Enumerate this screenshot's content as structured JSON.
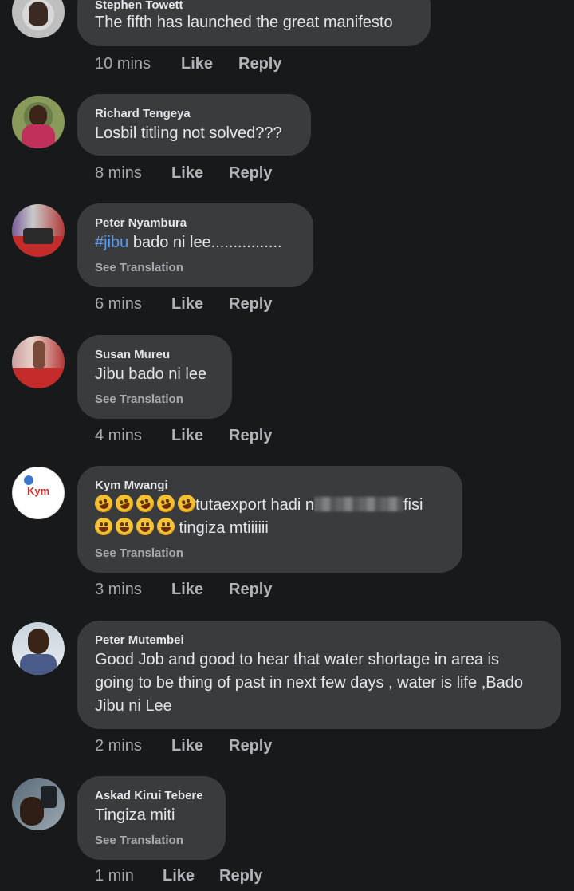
{
  "comments": [
    {
      "author": "Stephen Towett",
      "text": "The fifth has launched the great manifesto",
      "time": "10 mins",
      "like": "Like",
      "reply": "Reply"
    },
    {
      "author": "Richard Tengeya",
      "text": "Losbil titling not solved???",
      "time": "8 mins",
      "like": "Like",
      "reply": "Reply"
    },
    {
      "author": "Peter Nyambura",
      "hashtag": "#jibu",
      "text_rest": " bado ni lee................",
      "translate": "See Translation",
      "time": "6 mins",
      "like": "Like",
      "reply": "Reply"
    },
    {
      "author": "Susan Mureu",
      "text": "Jibu bado ni lee",
      "translate": "See Translation",
      "time": "4 mins",
      "like": "Like",
      "reply": "Reply"
    },
    {
      "author": "Kym Mwangi",
      "avatar_text": "Kym",
      "line1_a": "tutaexport hadi n",
      "line1_b": "fisi",
      "line2": " tingiza mtiiiiii",
      "translate": "See Translation",
      "time": "3 mins",
      "like": "Like",
      "reply": "Reply"
    },
    {
      "author": "Peter Mutembei",
      "lines": [
        "Good Job and good to hear that water shortage in area is",
        "going to be thing of past in next few days , water is life ,Bado",
        "Jibu ni Lee"
      ],
      "time": "2 mins",
      "like": "Like",
      "reply": "Reply"
    },
    {
      "author": "Askad Kirui Tebere",
      "text": "Tingiza miti",
      "translate": "See Translation",
      "time": "1 min",
      "like": "Like",
      "reply": "Reply"
    }
  ],
  "colors": {
    "background": "#18191a",
    "bubble": "#3a3b3c",
    "hashtag": "#5b9bf2"
  },
  "icons": {
    "laugh_emoji": "rolling-on-floor-laughing-emoji",
    "grin_emoji": "grinning-face-emoji"
  }
}
